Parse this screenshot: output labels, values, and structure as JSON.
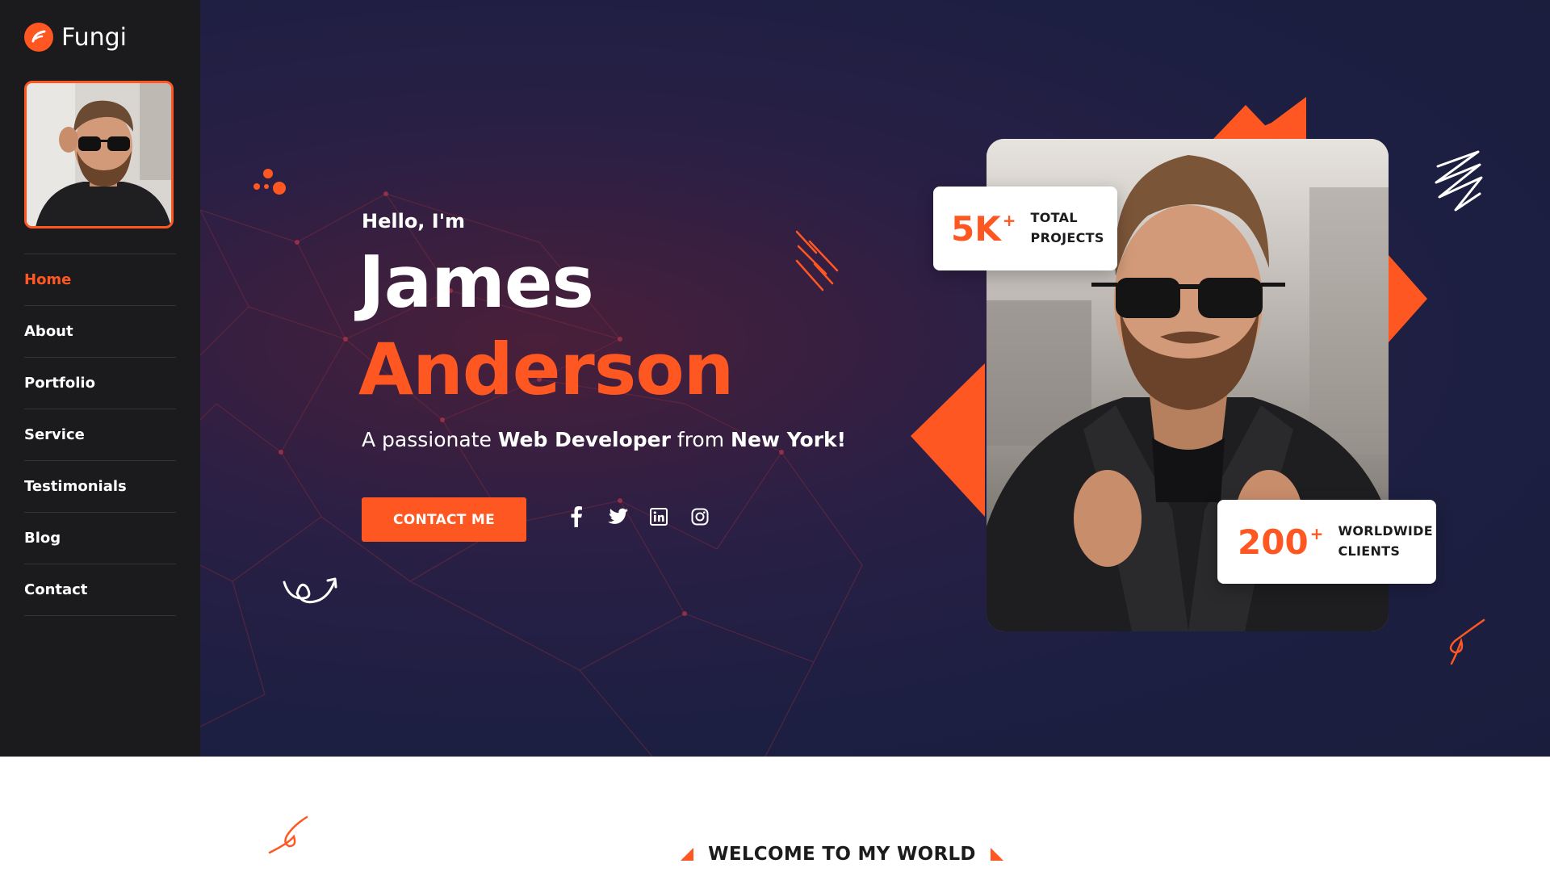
{
  "brand": {
    "name": "Fungi",
    "accent": "#ff5722",
    "sidebar_bg": "#1b1b1e",
    "hero_bg": "#1d1f42"
  },
  "sidebar": {
    "avatar_alt": "profile-photo",
    "items": [
      {
        "label": "Home",
        "active": true
      },
      {
        "label": "About",
        "active": false
      },
      {
        "label": "Portfolio",
        "active": false
      },
      {
        "label": "Service",
        "active": false
      },
      {
        "label": "Testimonials",
        "active": false
      },
      {
        "label": "Blog",
        "active": false
      },
      {
        "label": "Contact",
        "active": false
      }
    ]
  },
  "hero": {
    "greeting": "Hello, I'm",
    "first_name": "James",
    "last_name": "Anderson",
    "tagline": {
      "pre": "A passionate ",
      "role": "Web Developer",
      "mid": " from ",
      "city": "New York!"
    },
    "cta_label": "CONTACT ME",
    "socials": [
      "facebook-icon",
      "twitter-icon",
      "linkedin-icon",
      "instagram-icon"
    ],
    "stats": [
      {
        "number": "5K",
        "suffix": "+",
        "label_line1": "TOTAL",
        "label_line2": "PROJECTS"
      },
      {
        "number": "200",
        "suffix": "+",
        "label_line1": "WORLDWIDE",
        "label_line2": "CLIENTS"
      }
    ]
  },
  "section": {
    "welcome": "WELCOME TO MY WORLD"
  }
}
